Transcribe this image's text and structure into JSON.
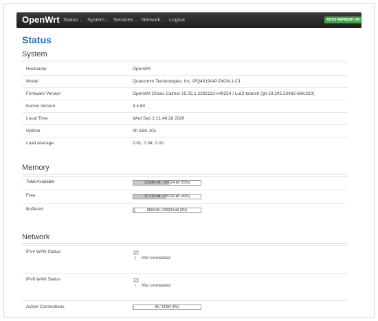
{
  "nav": {
    "brand": "OpenWrt",
    "items": [
      {
        "label": "Status",
        "caret": "⌄"
      },
      {
        "label": "System",
        "caret": "⌄"
      },
      {
        "label": "Services",
        "caret": "⌄"
      },
      {
        "label": "Network",
        "caret": "⌄"
      },
      {
        "label": "Logout",
        "caret": ""
      }
    ],
    "refresh_badge": "AUTO REFRESH ON",
    "badge_color": "#46a546"
  },
  "page": {
    "title": "Status",
    "title_color": "#2a6ebb"
  },
  "system": {
    "title": "System",
    "rows": [
      {
        "label": "Hostname",
        "value": "OpenWrt"
      },
      {
        "label": "Model",
        "value": "Qualcomm Technologies, Inc. IPQ4019/AP-DK04.1-C1"
      },
      {
        "label": "Firmware Version",
        "value": "OpenWrt Chaos Calmer 15.05.1 2292113+r49254 / LuCI branch (git-18.205.33482-6bfc320)"
      },
      {
        "label": "Kernel Version",
        "value": "4.4.60"
      },
      {
        "label": "Local Time",
        "value": "Wed Sep 2 21:48:28 2020"
      },
      {
        "label": "Uptime",
        "value": "0h 16m 10s"
      },
      {
        "label": "Load Average",
        "value": "0.01, 0.04, 0.00"
      }
    ]
  },
  "memory": {
    "title": "Memory",
    "rows": [
      {
        "label": "Total Available",
        "bar_text": "125684 kB / 235324 kB (53%)",
        "fraction": 0.53
      },
      {
        "label": "Free",
        "bar_text": "117120 kB / 235324 kB (49%)",
        "fraction": 0.49
      },
      {
        "label": "Buffered",
        "bar_text": "8564 kB / 235324 kB (3%)",
        "fraction": 0.03
      }
    ]
  },
  "network": {
    "title": "Network",
    "ipv4": {
      "label": "IPv4 WAN Status",
      "status": "Not connected",
      "icon": "network-disconnected-icon"
    },
    "ipv6": {
      "label": "IPv6 WAN Status",
      "status": "Not connected",
      "icon": "network-disconnected-icon"
    },
    "connections": {
      "label": "Active Connections",
      "bar_text": "96 / 16384 (0%)",
      "fraction": 0.006
    }
  }
}
